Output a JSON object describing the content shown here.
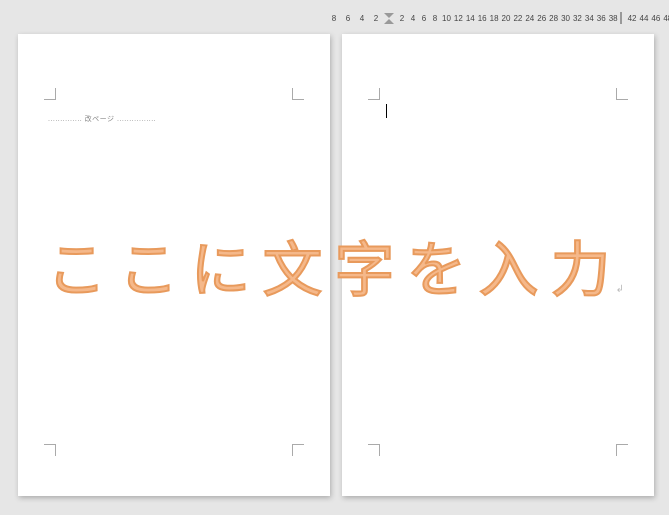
{
  "ruler": {
    "left_numbers": [
      "8",
      "6",
      "4",
      "2"
    ],
    "right_numbers": [
      "2",
      "4",
      "6",
      "8",
      "10",
      "12",
      "14",
      "16",
      "18",
      "20",
      "22",
      "24",
      "26",
      "28",
      "30",
      "32",
      "34",
      "36",
      "38"
    ],
    "tail_numbers": [
      "42",
      "44",
      "46",
      "48"
    ]
  },
  "page1": {
    "header": ".............. 改ページ ................"
  },
  "watermark": {
    "text": "ここに文字を入力"
  },
  "para_mark": "↲"
}
